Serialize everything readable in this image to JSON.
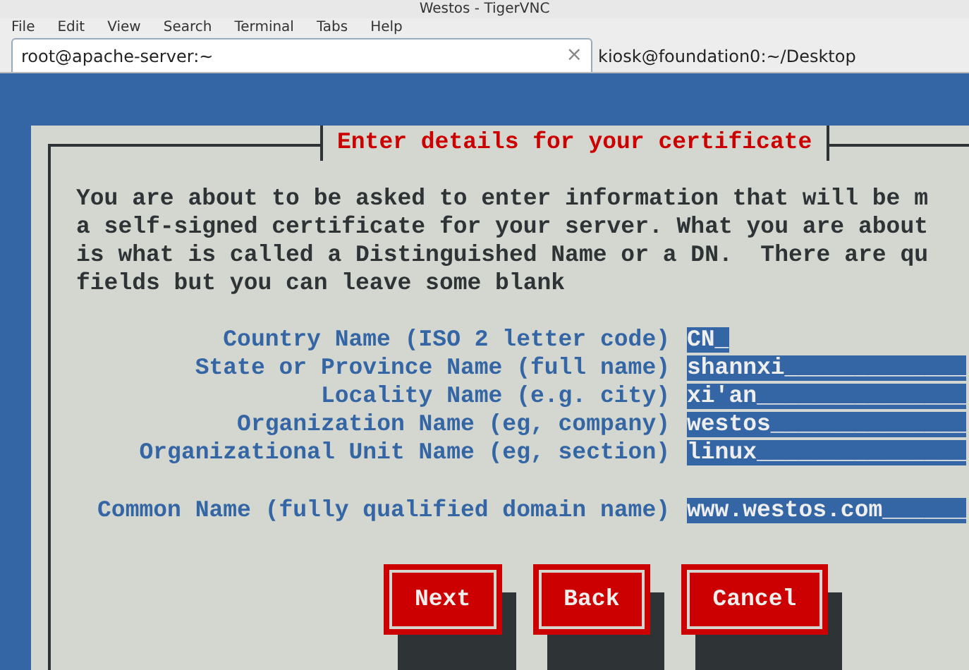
{
  "window": {
    "title": "Westos - TigerVNC"
  },
  "menu": [
    "File",
    "Edit",
    "View",
    "Search",
    "Terminal",
    "Tabs",
    "Help"
  ],
  "tabs": [
    {
      "label": "root@apache-server:~",
      "selected": true,
      "close": "×"
    },
    {
      "label": "kiosk@foundation0:~/Desktop",
      "selected": false
    }
  ],
  "dialog": {
    "title": "Enter details for your certificate",
    "intro": [
      "You are about to be asked to enter information that will be m",
      "a self-signed certificate for your server. What you are about",
      "is what is called a Distinguished Name or a DN.  There are qu",
      "fields but you can leave some blank"
    ],
    "fields": [
      {
        "label": "Country Name (ISO 2 letter code)",
        "value": "CN_"
      },
      {
        "label": "State or Province Name (full name)",
        "value": "shannxi_____________"
      },
      {
        "label": "Locality Name (e.g. city)",
        "value": "xi'an_______________"
      },
      {
        "label": "Organization Name (eg, company)",
        "value": "westos______________"
      },
      {
        "label": "Organizational Unit Name (eg, section)",
        "value": "linux_______________"
      }
    ],
    "common_name": {
      "label": "Common Name (fully qualified domain name)",
      "value": "www.westos.com______"
    },
    "buttons": [
      "Next",
      "Back",
      "Cancel"
    ]
  }
}
